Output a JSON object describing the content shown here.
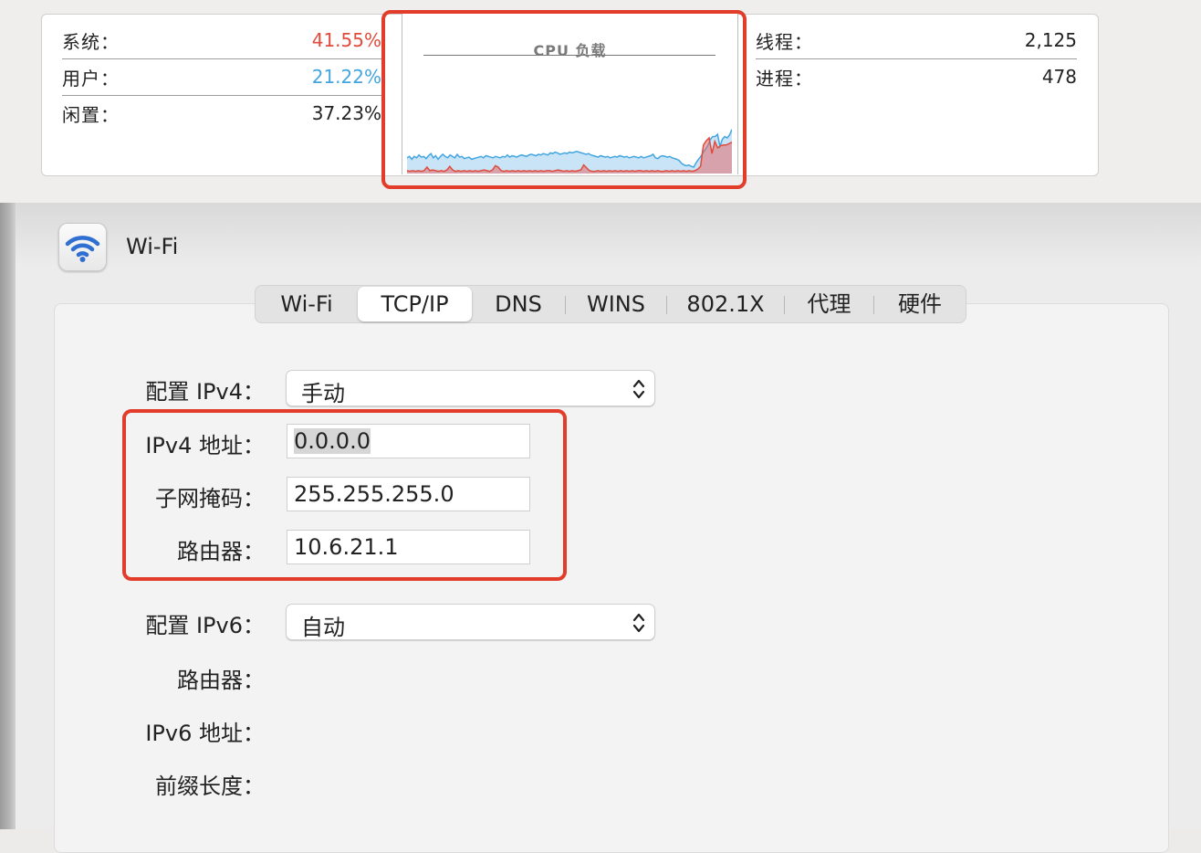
{
  "activity_monitor": {
    "stats_left": [
      {
        "label": "系统：",
        "value": "41.55%"
      },
      {
        "label": "用户：",
        "value": "21.22%"
      },
      {
        "label": "闲置：",
        "value": "37.23%"
      }
    ],
    "stats_right": [
      {
        "label": "线程：",
        "value": "2,125"
      },
      {
        "label": "进程：",
        "value": "478"
      }
    ],
    "chart_title": "CPU 负载",
    "colors": {
      "system": "#e14b3b",
      "user": "#44a6e0"
    }
  },
  "chart_data": {
    "type": "area",
    "title": "CPU 负载",
    "ylim": [
      0,
      100
    ],
    "series": [
      {
        "name": "系统",
        "color": "#e14b3b",
        "values": [
          4,
          3,
          4,
          3,
          4,
          3,
          4,
          9,
          4,
          5,
          4,
          3,
          4,
          3,
          5,
          10,
          5,
          3,
          4,
          3,
          4,
          3,
          4,
          3,
          4,
          3,
          4,
          5,
          4,
          3,
          5,
          11,
          9,
          4,
          3,
          4,
          3,
          4,
          3,
          4,
          3,
          4,
          3,
          4,
          3,
          4,
          3,
          4,
          3,
          4,
          4,
          3,
          4,
          5,
          4,
          3,
          4,
          3,
          4,
          3,
          4,
          5,
          12,
          8,
          4,
          3,
          3,
          4,
          3,
          4,
          3,
          4,
          3,
          4,
          3,
          4,
          3,
          4,
          3,
          4,
          3,
          4,
          4,
          3,
          4,
          3,
          4,
          3,
          4,
          3,
          3,
          4,
          3,
          4,
          3,
          4,
          3,
          4,
          3,
          4,
          3,
          4,
          6,
          10,
          40,
          46,
          50,
          28,
          45,
          36,
          39,
          40,
          40,
          42,
          44
        ]
      },
      {
        "name": "用户",
        "color": "#44a6e0",
        "values": [
          22,
          24,
          20,
          24,
          22,
          26,
          23,
          24,
          21,
          25,
          28,
          22,
          25,
          20,
          24,
          27,
          24,
          22,
          26,
          24,
          22,
          27,
          23,
          24,
          21,
          22,
          23,
          20,
          21,
          22,
          23,
          24,
          22,
          25,
          24,
          23,
          22,
          24,
          23,
          22,
          24,
          23,
          26,
          23,
          25,
          24,
          23,
          25,
          26,
          25,
          24,
          26,
          27,
          26,
          25,
          27,
          26,
          28,
          27,
          26,
          29,
          28,
          30,
          29,
          27,
          28,
          29,
          28,
          30,
          29,
          30,
          31,
          30,
          29,
          28,
          27,
          28,
          26,
          25,
          24,
          23,
          25,
          24,
          23,
          24,
          22,
          23,
          24,
          23,
          25,
          24,
          23,
          24,
          22,
          23,
          24,
          23,
          22,
          24,
          22,
          23,
          24,
          25,
          27,
          22,
          21,
          24,
          25,
          24,
          23,
          24,
          22,
          21,
          20,
          18,
          14,
          12,
          11,
          12,
          10,
          9,
          15,
          20,
          24,
          30,
          34,
          40,
          48,
          52,
          52,
          55,
          38,
          48,
          52,
          50,
          54,
          62
        ]
      }
    ]
  },
  "network": {
    "service_name": "Wi-Fi",
    "tabs": [
      "Wi-Fi",
      "TCP/IP",
      "DNS",
      "WINS",
      "802.1X",
      "代理",
      "硬件"
    ],
    "active_tab": "TCP/IP",
    "fields": {
      "configure_ipv4": {
        "label": "配置 IPv4：",
        "value": "手动"
      },
      "ipv4_address": {
        "label": "IPv4 地址：",
        "value": "0.0.0.0"
      },
      "subnet_mask": {
        "label": "子网掩码：",
        "value": "255.255.255.0"
      },
      "router": {
        "label": "路由器：",
        "value": "10.6.21.1"
      },
      "configure_ipv6": {
        "label": "配置 IPv6：",
        "value": "自动"
      },
      "router_v6": {
        "label": "路由器：",
        "value": ""
      },
      "ipv6_address": {
        "label": "IPv6 地址：",
        "value": ""
      },
      "prefix_length": {
        "label": "前缀长度：",
        "value": ""
      }
    }
  }
}
